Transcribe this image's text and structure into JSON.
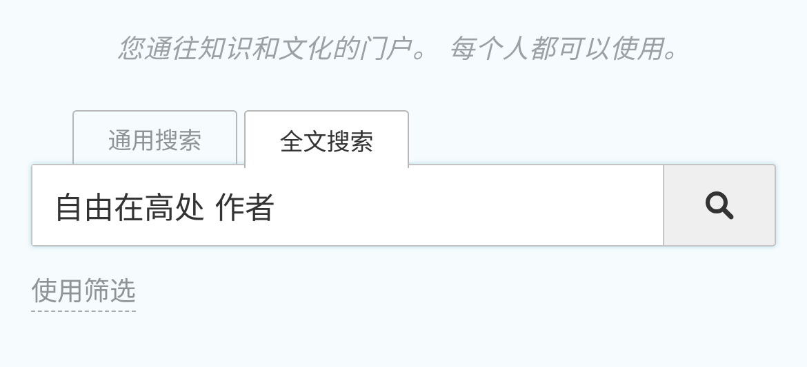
{
  "tagline": "您通往知识和文化的门户。 每个人都可以使用。",
  "tabs": [
    {
      "label": "通用搜索",
      "active": false
    },
    {
      "label": "全文搜索",
      "active": true
    }
  ],
  "search": {
    "value": "自由在高处 作者",
    "button_icon": "search-icon"
  },
  "filters": {
    "label": "使用筛选"
  },
  "colors": {
    "background": "#f6fbfd",
    "tagline": "#9aa1a5",
    "text": "#333333",
    "muted": "#8f9396",
    "border": "#c4c4c4",
    "button_bg": "#efefef",
    "focus_glow": "#78bed7"
  }
}
